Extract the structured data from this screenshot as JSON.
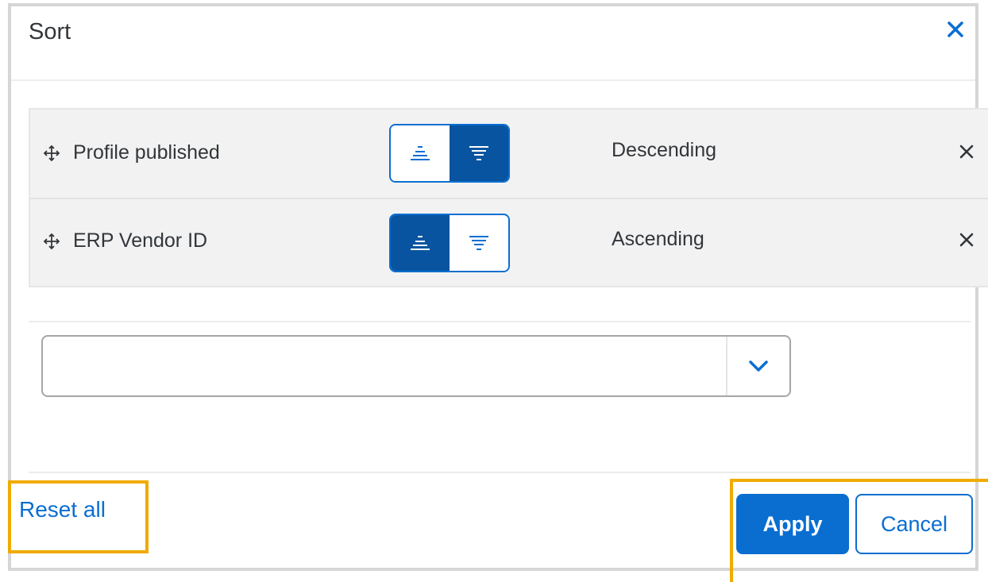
{
  "dialog": {
    "title": "Sort",
    "close_icon": "close-icon"
  },
  "sort_items": [
    {
      "label": "Profile published",
      "direction": "Descending",
      "ascending_selected": false,
      "descending_selected": true,
      "move_icon": "move-icon",
      "remove_icon": "remove-icon"
    },
    {
      "label": "ERP Vendor ID",
      "direction": "Ascending",
      "ascending_selected": true,
      "descending_selected": false,
      "move_icon": "move-icon",
      "remove_icon": "remove-icon"
    }
  ],
  "add_sort_field": {
    "value": "",
    "dropdown_icon": "chevron-down-icon"
  },
  "footer": {
    "reset_label": "Reset all",
    "apply_label": "Apply",
    "cancel_label": "Cancel"
  },
  "colors": {
    "accent": "#0a6ed1",
    "selected_segment": "#0854a0",
    "highlight": "#f0ab00",
    "text": "#32363a"
  }
}
